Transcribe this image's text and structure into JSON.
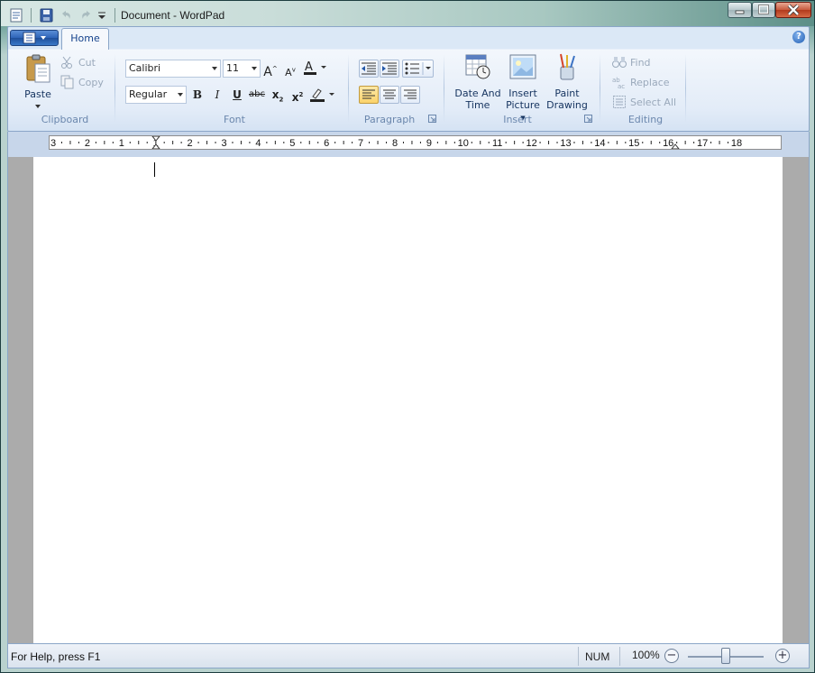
{
  "window": {
    "title": "Document - WordPad"
  },
  "ribbon": {
    "tabs": [
      {
        "label": "Home"
      }
    ],
    "clipboard": {
      "label": "Clipboard",
      "paste": "Paste",
      "cut": "Cut",
      "copy": "Copy"
    },
    "font": {
      "label": "Font",
      "family": "Calibri",
      "size": "11",
      "style": "Regular"
    },
    "paragraph": {
      "label": "Paragraph"
    },
    "insert": {
      "label": "Insert",
      "date_time_line1": "Date And",
      "date_time_line2": "Time",
      "picture_line1": "Insert",
      "picture_line2": "Picture",
      "paint_line1": "Paint",
      "paint_line2": "Drawing"
    },
    "editing": {
      "label": "Editing",
      "find": "Find",
      "replace": "Replace",
      "select_all": "Select All"
    }
  },
  "ruler": {
    "labels": [
      "3",
      "2",
      "1",
      "1",
      "2",
      "3",
      "4",
      "5",
      "6",
      "7",
      "8",
      "9",
      "10",
      "11",
      "12",
      "13",
      "14",
      "15",
      "16",
      "17",
      "18"
    ]
  },
  "statusbar": {
    "help": "For Help, press F1",
    "num": "NUM",
    "zoom": "100%",
    "zoom_fraction": 0.5
  },
  "colors": {
    "ribbon_label": "#6b87ad",
    "accent": "#15428b",
    "doc_background": "#ababab"
  }
}
